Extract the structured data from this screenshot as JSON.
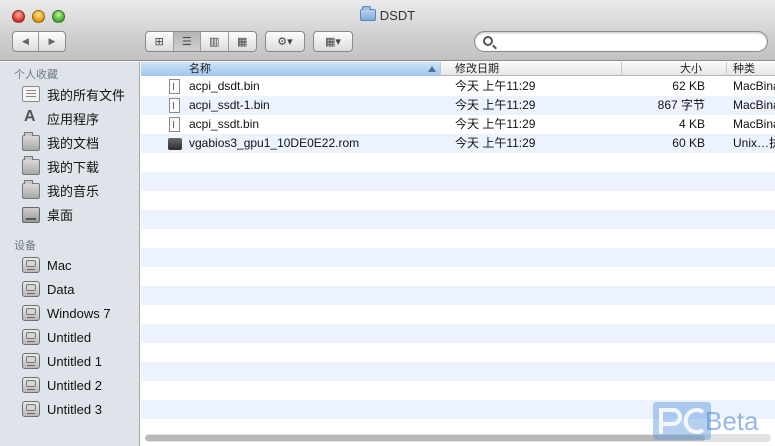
{
  "window": {
    "title": "DSDT"
  },
  "toolbar": {
    "back_label": "◀",
    "forward_label": "▶",
    "view_icons": "⊞",
    "view_list": "☰",
    "view_columns": "▥",
    "view_coverflow": "▦",
    "action_label": "⚙▾",
    "arrange_label": "▦▾",
    "search_value": ""
  },
  "sidebar": {
    "favorites_header": "个人收藏",
    "favorites": [
      {
        "label": "我的所有文件",
        "icon": "all-files-icon"
      },
      {
        "label": "应用程序",
        "icon": "applications-icon"
      },
      {
        "label": "我的文档",
        "icon": "folder-icon"
      },
      {
        "label": "我的下载",
        "icon": "folder-icon"
      },
      {
        "label": "我的音乐",
        "icon": "folder-icon"
      },
      {
        "label": "桌面",
        "icon": "desktop-icon"
      }
    ],
    "devices_header": "设备",
    "devices": [
      {
        "label": "Mac",
        "icon": "disk-icon"
      },
      {
        "label": "Data",
        "icon": "disk-icon"
      },
      {
        "label": "Windows 7",
        "icon": "disk-icon"
      },
      {
        "label": "Untitled",
        "icon": "disk-icon"
      },
      {
        "label": "Untitled 1",
        "icon": "disk-icon"
      },
      {
        "label": "Untitled 2",
        "icon": "disk-icon"
      },
      {
        "label": "Untitled 3",
        "icon": "disk-icon"
      }
    ]
  },
  "columns": {
    "name": "名称",
    "date": "修改日期",
    "size": "大小",
    "kind": "种类"
  },
  "files": [
    {
      "name": "acpi_dsdt.bin",
      "date": "今天 上午11:29",
      "size": "62 KB",
      "kind": "MacBinar",
      "icon": "document-icon"
    },
    {
      "name": "acpi_ssdt-1.bin",
      "date": "今天 上午11:29",
      "size": "867 字节",
      "kind": "MacBinar",
      "icon": "document-icon"
    },
    {
      "name": "acpi_ssdt.bin",
      "date": "今天 上午11:29",
      "size": "4 KB",
      "kind": "MacBinar",
      "icon": "document-icon"
    },
    {
      "name": "vgabios3_gpu1_10DE0E22.rom",
      "date": "今天 上午11:29",
      "size": "60 KB",
      "kind": "Unix…执",
      "icon": "executable-icon"
    }
  ],
  "watermark": {
    "text": "Beta"
  }
}
